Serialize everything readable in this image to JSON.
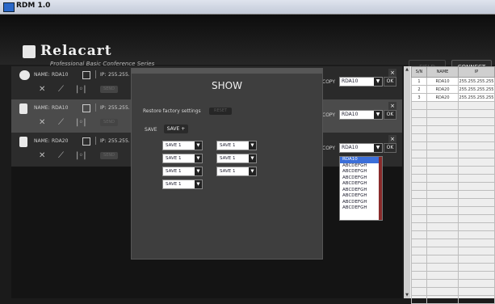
{
  "window": {
    "title": "RDM 1.0"
  },
  "header": {
    "brand": "Relacart",
    "subtitle": "Professional Basic Conference Series",
    "field_button": "FIELD",
    "connect_button": "CONNECT"
  },
  "devices": [
    {
      "name_label": "NAME:",
      "name": "RDA10",
      "ip_label": "IP:",
      "ip": "255.255.",
      "btn": "SEND",
      "copy_label": "COPY",
      "copy_value": "RDA10",
      "ok": "OK"
    },
    {
      "name_label": "NAME:",
      "name": "RDA10",
      "ip_label": "IP:",
      "ip": "255.255.",
      "btn": "SEND",
      "copy_label": "COPY",
      "copy_value": "RDA10",
      "ok": "OK"
    },
    {
      "name_label": "NAME:",
      "name": "RDA20",
      "ip_label": "IP:",
      "ip": "255.255.",
      "btn": "SEND",
      "copy_label": "COPY",
      "copy_value": "RDA10",
      "ok": "OK"
    }
  ],
  "copy_dropdown": {
    "options": [
      "RDA10",
      "ABCDEFGH",
      "ABCDEFGH",
      "ABCDEFGH",
      "ABCDEFGH",
      "ABCDEFGH",
      "ABCDEFGH",
      "ABCDEFGH",
      "ABCDEFGH"
    ]
  },
  "show_dialog": {
    "title": "SHOW",
    "restore_label": "Restore factory settings",
    "reset_button": "RESET",
    "save_label": "SAVE",
    "save_button": "SAVE +",
    "selects": [
      "SAVE 1",
      "SAVE 1",
      "SAVE 1",
      "SAVE 1",
      "SAVE 1",
      "SAVE 1",
      "SAVE 1"
    ]
  },
  "table": {
    "headers": [
      "S/N",
      "NAME",
      "IP"
    ],
    "rows": [
      [
        "1",
        "RDA10",
        "255.255.255.255"
      ],
      [
        "2",
        "RDA20",
        "255.255.255.255"
      ],
      [
        "3",
        "RDA20",
        "255.255.255.255"
      ]
    ]
  }
}
